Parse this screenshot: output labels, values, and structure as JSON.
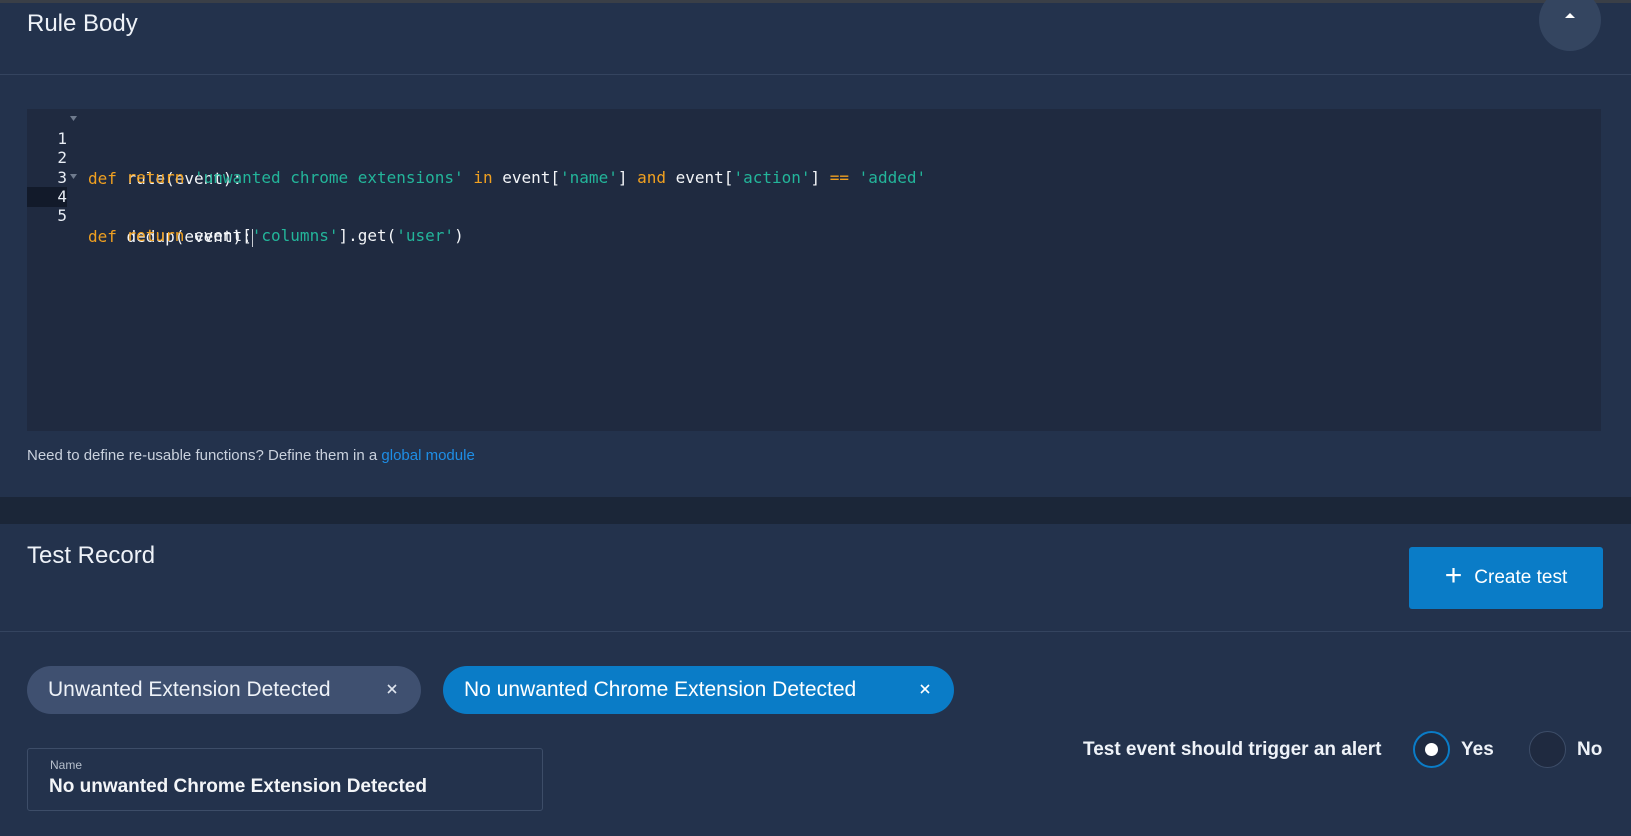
{
  "rule_body": {
    "title": "Rule Body",
    "hint_text": "Need to define re-usable functions? Define them in a ",
    "hint_link": "global module"
  },
  "editor": {
    "line_numbers": [
      "1",
      "2",
      "3",
      "4",
      "5"
    ],
    "lines": [
      "def rule(event):",
      "    return 'unwanted chrome extensions' in event['name'] and event['action'] == 'added'",
      "",
      "def dedup(event):",
      "    return event['columns'].get('user')"
    ],
    "active_line": 4
  },
  "test_record": {
    "title": "Test Record",
    "create_button": "Create test",
    "create_icon": "+",
    "tests": [
      {
        "label": "Unwanted Extension Detected",
        "selected": false
      },
      {
        "label": "No unwanted Chrome Extension Detected",
        "selected": true
      }
    ],
    "name_field": {
      "label": "Name",
      "value": "No unwanted Chrome Extension Detected"
    },
    "alert_question": "Test event should trigger an alert",
    "options": {
      "yes": "Yes",
      "no": "No"
    },
    "selected_option": "yes"
  },
  "colors": {
    "panel_bg": "#23324c",
    "page_bg": "#1b2638",
    "editor_bg": "#1f2a40",
    "accent": "#0a7cc7",
    "keyword": "#f0a020",
    "string": "#23b59a",
    "link": "#1e8ee6"
  },
  "icons": [
    "chevron-up-icon",
    "fold-arrow-icon",
    "plus-icon",
    "close-icon"
  ]
}
